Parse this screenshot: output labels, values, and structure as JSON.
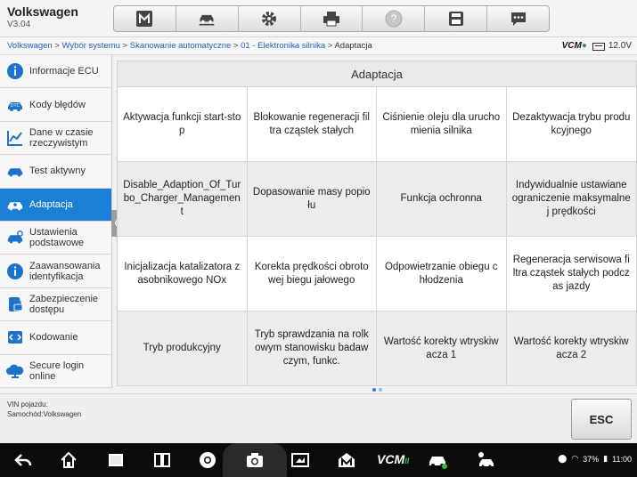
{
  "header": {
    "brand": "Volkswagen",
    "version": "V3.04",
    "toolbar": [
      {
        "icon": "home-icon"
      },
      {
        "icon": "vehicle-lift-icon"
      },
      {
        "icon": "gear-icon"
      },
      {
        "icon": "printer-icon"
      },
      {
        "icon": "help-icon"
      },
      {
        "icon": "save-icon"
      },
      {
        "icon": "message-icon"
      }
    ]
  },
  "breadcrumb": {
    "items": [
      "Volkswagen",
      "Wybór systemu",
      "Skanowanie automatyczne",
      "01 - Elektronika silnika"
    ],
    "current": "Adaptacja",
    "separator": " > "
  },
  "status": {
    "vcm": "VCM",
    "voltage": "12.0V"
  },
  "sidebar": {
    "items": [
      {
        "label": "Informacje ECU",
        "icon": "info-icon"
      },
      {
        "label": "Kody błędów",
        "icon": "dtc-icon"
      },
      {
        "label": "Dane w czasie rzeczywistym",
        "icon": "chart-icon"
      },
      {
        "label": "Test aktywny",
        "icon": "car-test-icon"
      },
      {
        "label": "Adaptacja",
        "icon": "car-adapt-icon",
        "active": true
      },
      {
        "label": "Ustawienia podstawowe",
        "icon": "car-settings-icon"
      },
      {
        "label": "Zaawansowania identyfikacja",
        "icon": "info-icon"
      },
      {
        "label": "Zabezpieczenie dostępu",
        "icon": "lock-icon"
      },
      {
        "label": "Kodowanie",
        "icon": "code-icon"
      },
      {
        "label": "Secure login online",
        "icon": "cloud-login-icon"
      }
    ]
  },
  "panel": {
    "title": "Adaptacja",
    "cells": [
      "Aktywacja funkcji start-stop",
      "Blokowanie regeneracji filtra cząstek stałych",
      "Ciśnienie oleju dla uruchomienia silnika",
      "Dezaktywacja trybu produkcyjnego",
      "Disable_Adaption_Of_Turbo_Charger_Management",
      "Dopasowanie masy popiołu",
      "Funkcja ochronna",
      "Indywidualnie ustawiane ograniczenie maksymalnej prędkości",
      "Inicjalizacja katalizatora zasobnikowego NOx",
      "Korekta prędkości obrotowej biegu jałowego",
      "Odpowietrzanie obiegu chłodzenia",
      "Regeneracja serwisowa filtra cząstek stałych podczas jazdy",
      "Tryb produkcyjny",
      "Tryb sprawdzania na rolkowym stanowisku badawczym, funkc.",
      "Wartość korekty wtryskiwacza 1",
      "Wartość korekty wtryskiwacza 2"
    ]
  },
  "footer": {
    "vin_label": "VIN pojazdu:",
    "vehicle_label": "Samochód:Volkswagen",
    "esc_label": "ESC"
  },
  "navbar": {
    "vcm": "VCM",
    "vcm_badge": "II",
    "battery": "37%",
    "time": "11:00"
  },
  "colors": {
    "accent": "#1c7fd6",
    "vcm_green": "#2fa23a"
  }
}
